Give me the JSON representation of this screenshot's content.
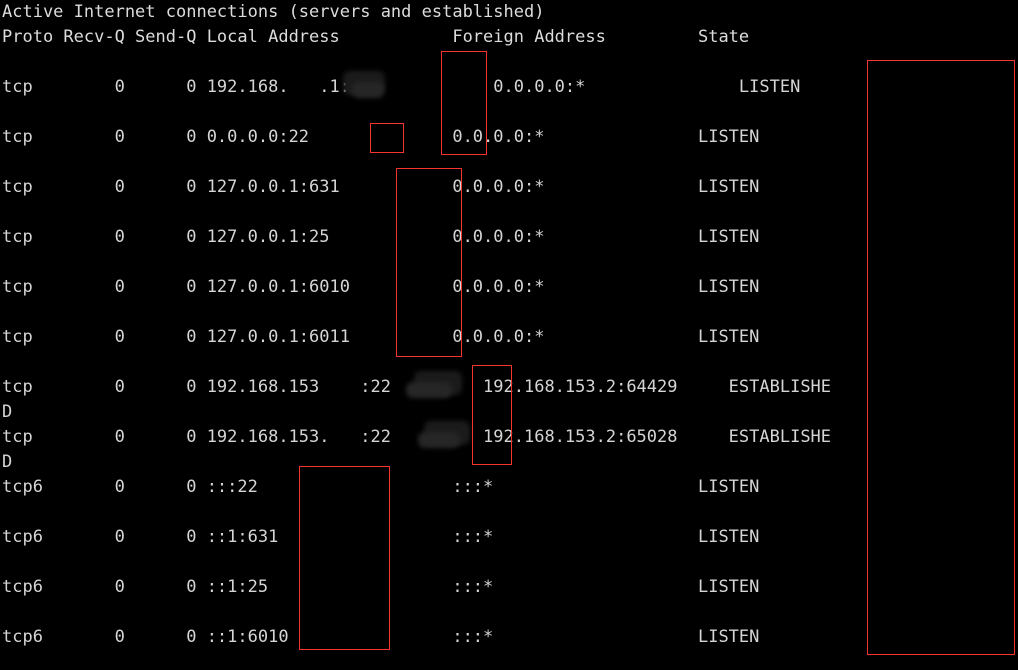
{
  "terminal": {
    "title_line": "Active Internet connections (servers and established)",
    "columns": {
      "proto": "Proto",
      "recvq": "Recv-Q",
      "sendq": "Send-Q",
      "local_address": "Local Address",
      "foreign_address": "Foreign Address",
      "state": "State"
    },
    "header_line": "Proto Recv-Q Send-Q Local Address           Foreign Address         State",
    "rows": [
      {
        "proto": "tcp",
        "recvq": "0",
        "sendq": "0",
        "local_address": "192.168.███.1:53",
        "local_address_redacted": true,
        "foreign_address": "0.0.0.0:*",
        "state": "LISTEN",
        "text": "tcp        0      0 192.168.   .1:53            0.0.0.0:*               LISTEN"
      },
      {
        "proto": "tcp",
        "recvq": "0",
        "sendq": "0",
        "local_address": "0.0.0.0:22",
        "local_address_redacted": false,
        "foreign_address": "0.0.0.0:*",
        "state": "LISTEN",
        "text": "tcp        0      0 0.0.0.0:22              0.0.0.0:*               LISTEN"
      },
      {
        "proto": "tcp",
        "recvq": "0",
        "sendq": "0",
        "local_address": "127.0.0.1:631",
        "local_address_redacted": false,
        "foreign_address": "0.0.0.0:*",
        "state": "LISTEN",
        "text": "tcp        0      0 127.0.0.1:631           0.0.0.0:*               LISTEN"
      },
      {
        "proto": "tcp",
        "recvq": "0",
        "sendq": "0",
        "local_address": "127.0.0.1:25",
        "local_address_redacted": false,
        "foreign_address": "0.0.0.0:*",
        "state": "LISTEN",
        "text": "tcp        0      0 127.0.0.1:25            0.0.0.0:*               LISTEN"
      },
      {
        "proto": "tcp",
        "recvq": "0",
        "sendq": "0",
        "local_address": "127.0.0.1:6010",
        "local_address_redacted": false,
        "foreign_address": "0.0.0.0:*",
        "state": "LISTEN",
        "text": "tcp        0      0 127.0.0.1:6010          0.0.0.0:*               LISTEN"
      },
      {
        "proto": "tcp",
        "recvq": "0",
        "sendq": "0",
        "local_address": "127.0.0.1:6011",
        "local_address_redacted": false,
        "foreign_address": "0.0.0.0:*",
        "state": "LISTEN",
        "text": "tcp        0      0 127.0.0.1:6011          0.0.0.0:*               LISTEN"
      },
      {
        "proto": "tcp",
        "recvq": "0",
        "sendq": "0",
        "local_address": "192.168.153.███:22",
        "local_address_redacted": true,
        "foreign_address": "192.168.153.2:64429",
        "state": "ESTABLISHED",
        "state_wrapped_head": "ESTABLISHE",
        "state_wrapped_tail": "D",
        "text": "tcp        0      0 192.168.153    :22         192.168.153.2:64429     ESTABLISHE"
      },
      {
        "proto": "tcp",
        "recvq": "0",
        "sendq": "0",
        "local_address": "192.168.153.███:22",
        "local_address_redacted": true,
        "foreign_address": "192.168.153.2:65028",
        "state": "ESTABLISHED",
        "state_wrapped_head": "ESTABLISHE",
        "state_wrapped_tail": "D",
        "text": "tcp        0      0 192.168.153.   :22         192.168.153.2:65028     ESTABLISHE"
      },
      {
        "proto": "tcp6",
        "recvq": "0",
        "sendq": "0",
        "local_address": ":::22",
        "local_address_redacted": false,
        "foreign_address": ":::*",
        "state": "LISTEN",
        "text": "tcp6       0      0 :::22                   :::*                    LISTEN"
      },
      {
        "proto": "tcp6",
        "recvq": "0",
        "sendq": "0",
        "local_address": "::1:631",
        "local_address_redacted": false,
        "foreign_address": ":::*",
        "state": "LISTEN",
        "text": "tcp6       0      0 ::1:631                 :::*                    LISTEN"
      },
      {
        "proto": "tcp6",
        "recvq": "0",
        "sendq": "0",
        "local_address": "::1:25",
        "local_address_redacted": false,
        "foreign_address": ":::*",
        "state": "LISTEN",
        "text": "tcp6       0      0 ::1:25                  :::*                    LISTEN"
      },
      {
        "proto": "tcp6",
        "recvq": "0",
        "sendq": "0",
        "local_address": "::1:6010",
        "local_address_redacted": false,
        "foreign_address": ":::*",
        "state": "LISTEN",
        "text": "tcp6       0      0 ::1:6010                :::*                    LISTEN"
      }
    ],
    "wrap_continuations": [
      {
        "text": "D"
      },
      {
        "text": "D"
      }
    ],
    "colors": {
      "background": "#000000",
      "foreground": "#d5d5d5",
      "annotation": "#f4352e"
    }
  },
  "annotations": {
    "boxes": [
      {
        "label": "highlight-port-53"
      },
      {
        "label": "highlight-port-22-any"
      },
      {
        "label": "highlight-ports-loopback"
      },
      {
        "label": "highlight-ports-established-ssh"
      },
      {
        "label": "highlight-ports-tcp6"
      },
      {
        "label": "highlight-state-column"
      }
    ]
  }
}
